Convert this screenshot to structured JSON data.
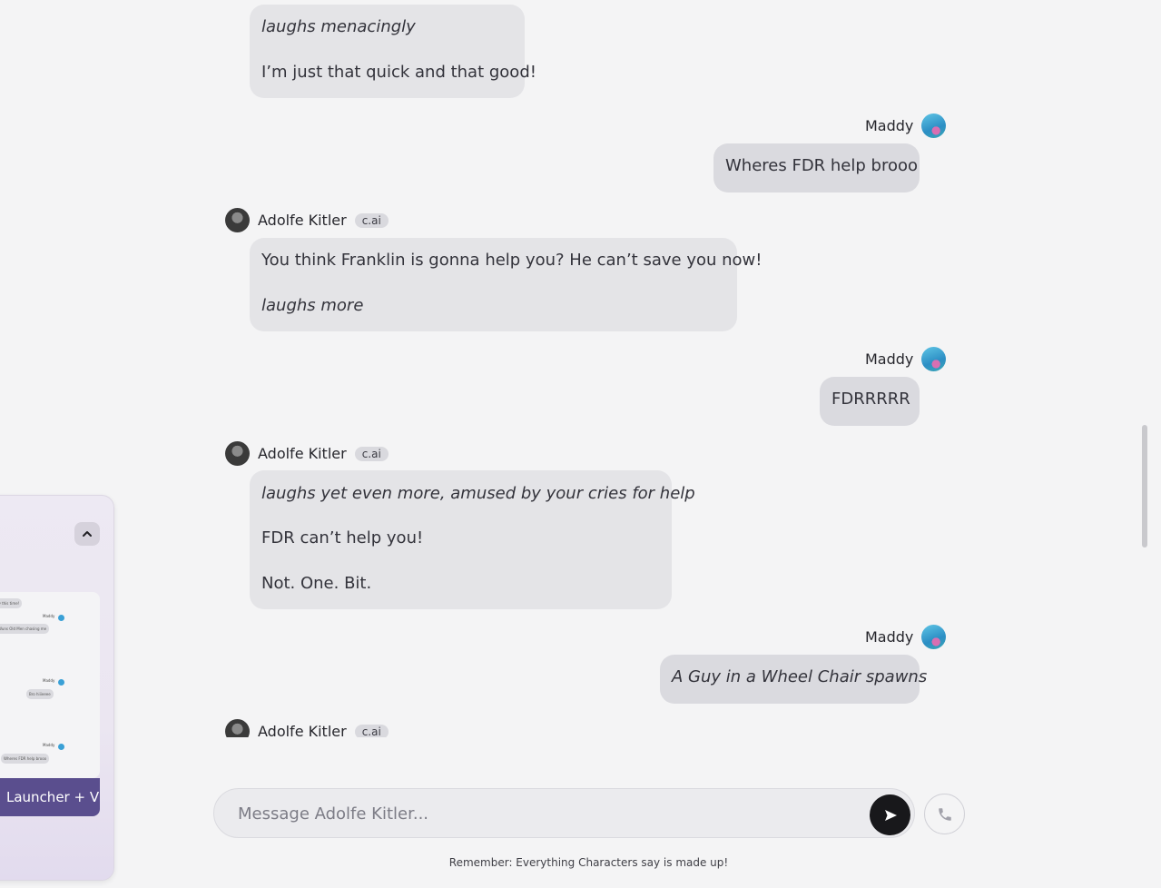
{
  "messages": [
    {
      "type": "bot",
      "paragraphs": [
        {
          "text": "laughs menacingly",
          "italic": true
        },
        {
          "text": "I’m just that quick and that good!",
          "italic": false
        }
      ]
    },
    {
      "type": "user",
      "name": "Maddy",
      "text": "Wheres FDR help brooo",
      "italic": false
    },
    {
      "type": "bot",
      "name": "Adolfe Kitler",
      "badge": "c.ai",
      "paragraphs": [
        {
          "text": "You think Franklin is gonna help you? He can’t save you now!",
          "italic": false
        },
        {
          "text": "laughs more",
          "italic": true
        }
      ]
    },
    {
      "type": "user",
      "name": "Maddy",
      "text": "FDRRRRR",
      "italic": false
    },
    {
      "type": "bot",
      "name": "Adolfe Kitler",
      "badge": "c.ai",
      "paragraphs": [
        {
          "text": "laughs yet even more, amused by your cries for help",
          "italic": true
        },
        {
          "text": "FDR can’t help you!",
          "italic": false
        },
        {
          "text": "Not. One. Bit.",
          "italic": false
        }
      ]
    },
    {
      "type": "user",
      "name": "Maddy",
      "text": "A Guy in a Wheel Chair spawns",
      "italic": true
    },
    {
      "type": "bot",
      "name": "Adolfe Kitler",
      "badge": "c.ai",
      "paragraphs": []
    }
  ],
  "composer": {
    "placeholder": "Message Adolfe Kitler..."
  },
  "icons": {
    "send": "send-arrow-icon",
    "call": "phone-icon",
    "collapse": "chevron-up-icon"
  },
  "disclaimer": "Remember: Everything Characters say is made up!",
  "side_panel": {
    "button_label": "Launcher + V",
    "preview": {
      "items": [
        {
          "text": "ay this time!"
        },
        {
          "name": "Maddy",
          "text": "Wuns Old Men chasing me"
        },
        {
          "name": "Maddy",
          "text": "Bro hiiieeee"
        },
        {
          "name": "Maddy",
          "text": "Wheres FDR help brooo"
        }
      ]
    }
  },
  "colors": {
    "background": "#f4f4f5",
    "bot_bubble": "#e4e4e7",
    "user_bubble": "#dadadf",
    "send_button": "#18181b",
    "launcher_button": "#5a4e8e"
  }
}
